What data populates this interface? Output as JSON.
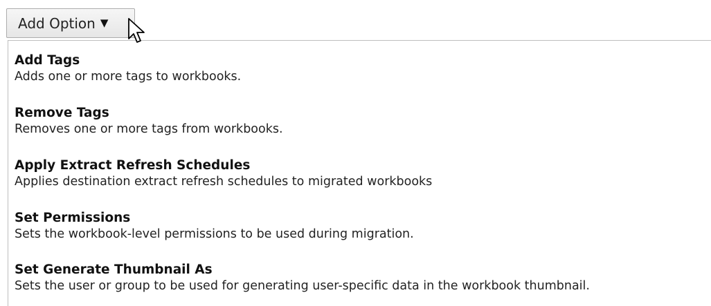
{
  "add_option_button": {
    "label": "Add Option",
    "caret": "▼"
  },
  "menu": {
    "items": [
      {
        "title": "Add Tags",
        "description": "Adds one or more tags to workbooks."
      },
      {
        "title": "Remove Tags",
        "description": "Removes one or more tags from workbooks."
      },
      {
        "title": "Apply Extract Refresh Schedules",
        "description": "Applies destination extract refresh schedules to migrated workbooks"
      },
      {
        "title": "Set Permissions",
        "description": "Sets the workbook-level permissions to be used during migration."
      },
      {
        "title": "Set Generate Thumbnail As",
        "description": "Sets the user or group to be used for generating user-specific data in the workbook thumbnail."
      }
    ]
  },
  "icons": {
    "dropdown": "caret-down-icon",
    "pointer": "mouse-pointer-icon"
  }
}
